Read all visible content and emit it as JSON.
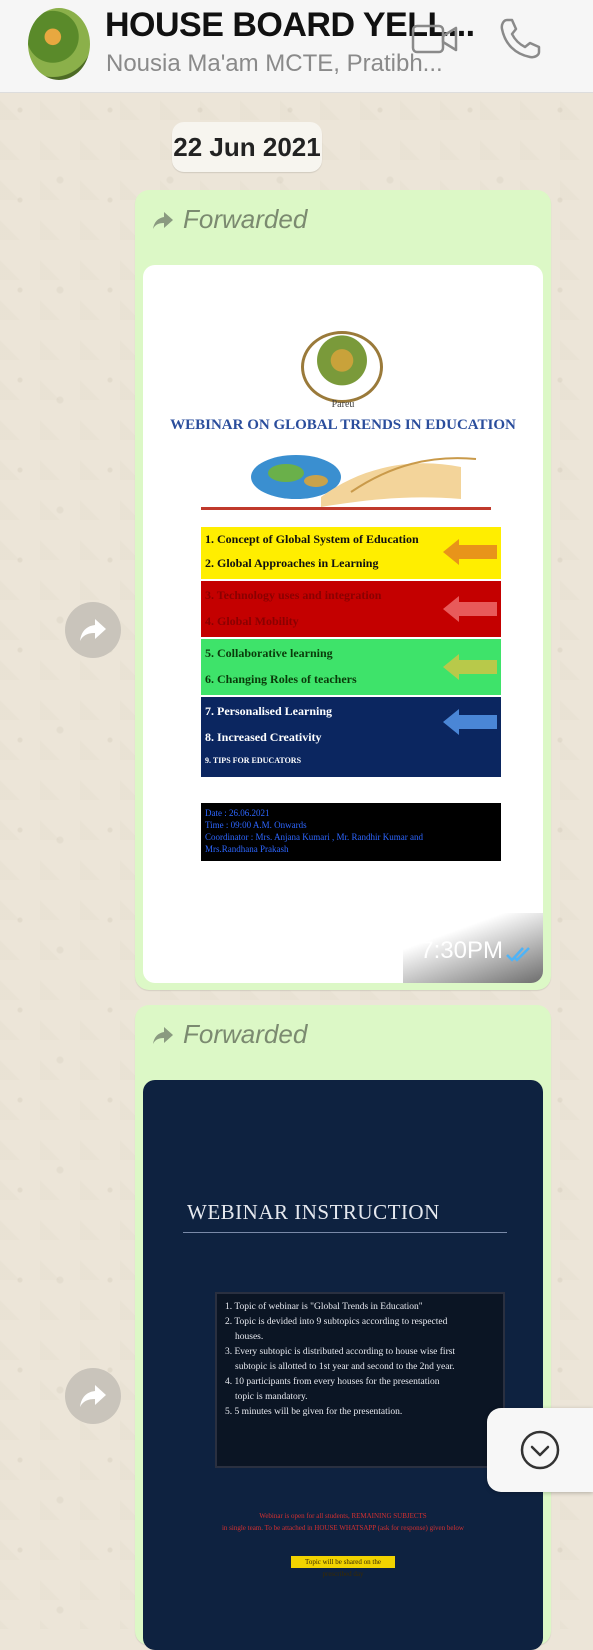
{
  "header": {
    "title": "HOUSE BOARD YELL...",
    "subtitle": "Nousia Ma'am MCTE, Pratibh...",
    "icons": [
      "video-call-icon",
      "voice-call-icon"
    ]
  },
  "date_pill": "22 Jun 2021",
  "messages": [
    {
      "forwarded_label": "Forwarded",
      "time": "7:30PM",
      "status": "read",
      "image": {
        "logo_caption": "Pareu",
        "title": "WEBINAR ON GLOBAL TRENDS IN EDUCATION",
        "topics": [
          {
            "label": "1. Concept of Global System of Education",
            "house": "YELLOW"
          },
          {
            "label": "2. Global Approaches in Learning",
            "house": "YELLOW"
          },
          {
            "label": "3. Technology uses and integration",
            "house": "RED"
          },
          {
            "label": "4. Global Mobility",
            "house": "RED"
          },
          {
            "label": "5. Collaborative learning",
            "house": "GREEN"
          },
          {
            "label": "6. Changing Roles of teachers",
            "house": "GREEN"
          },
          {
            "label": "7. Personalised Learning",
            "house": "BLUE"
          },
          {
            "label": "8. Increased Creativity",
            "house": "BLUE"
          },
          {
            "label": "9. TIPS FOR EDUCATORS",
            "house": "BLUE"
          }
        ],
        "details": [
          "Date : 26.06.2021",
          "Time : 09:00 A.M. Onwards",
          "Coordinator : Mrs. Anjana Kumari , Mr. Randhir Kumar and",
          "Mrs.Randhana Prakash"
        ]
      }
    },
    {
      "forwarded_label": "Forwarded",
      "image": {
        "title": "WEBINAR INSTRUCTION",
        "points": [
          "1. Topic of webinar is \"Global Trends in Education\"",
          "2. Topic is devided into 9 subtopics according to respected",
          "houses.",
          "3. Every subtopic is distributed according to house wise first",
          "subtopic is allotted to 1st year and second to the 2nd year.",
          "4. 10 participants from every houses for the presentation",
          "topic is mandatory.",
          "5. 5 minutes will be given for the presentation."
        ],
        "red_note": [
          "Webinar is open for all students, REMAINING SUBJECTS",
          "in single team. To be attached in HOUSE WHATSAPP (ask for response) given below"
        ],
        "yellow_note": "Topic will be shared on the prescribed day"
      }
    }
  ],
  "colors": {
    "bubble": "#dcf8c6",
    "read_tick": "#4fb3f6",
    "house_yellow": "#ffee00",
    "house_red": "#c40000",
    "house_green": "#3ee36a",
    "house_blue": "#0b2660"
  }
}
